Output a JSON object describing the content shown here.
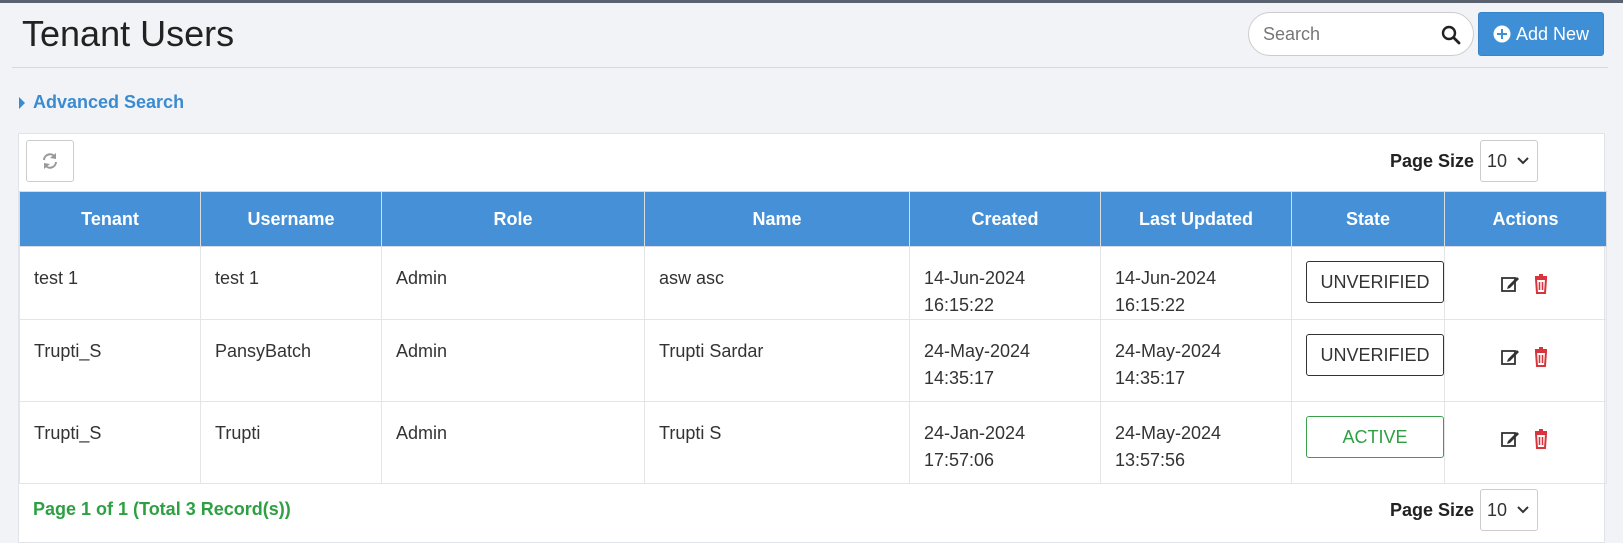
{
  "header": {
    "title": "Tenant Users",
    "search_placeholder": "Search",
    "add_label": "Add New"
  },
  "advanced_search_label": "Advanced Search",
  "pagination": {
    "page_size_label": "Page Size",
    "page_size_value": "10",
    "status": "Page 1 of 1 (Total 3 Record(s))"
  },
  "table": {
    "columns": [
      "Tenant",
      "Username",
      "Role",
      "Name",
      "Created",
      "Last Updated",
      "State",
      "Actions"
    ],
    "rows": [
      {
        "tenant": "test 1",
        "username": "test 1",
        "role": "Admin",
        "name": "asw asc",
        "created": "14-Jun-2024 16:15:22",
        "updated": "14-Jun-2024 16:15:22",
        "state": "UNVERIFIED"
      },
      {
        "tenant": "Trupti_S",
        "username": "PansyBatch",
        "role": "Admin",
        "name": "Trupti Sardar",
        "created": "24-May-2024 14:35:17",
        "updated": "24-May-2024 14:35:17",
        "state": "UNVERIFIED"
      },
      {
        "tenant": "Trupti_S",
        "username": "Trupti",
        "role": "Admin",
        "name": "Trupti S",
        "created": "24-Jan-2024 17:57:06",
        "updated": "24-May-2024 13:57:56",
        "state": "ACTIVE"
      }
    ]
  },
  "icons": {
    "search": "search-icon",
    "add": "plus-circle-icon",
    "refresh": "refresh-icon",
    "edit": "edit-icon",
    "delete": "trash-icon",
    "caret": "caret-right-icon"
  },
  "colors": {
    "primary": "#4590d6",
    "link": "#3a8bd0",
    "success": "#2ea043",
    "danger": "#d9343b"
  }
}
